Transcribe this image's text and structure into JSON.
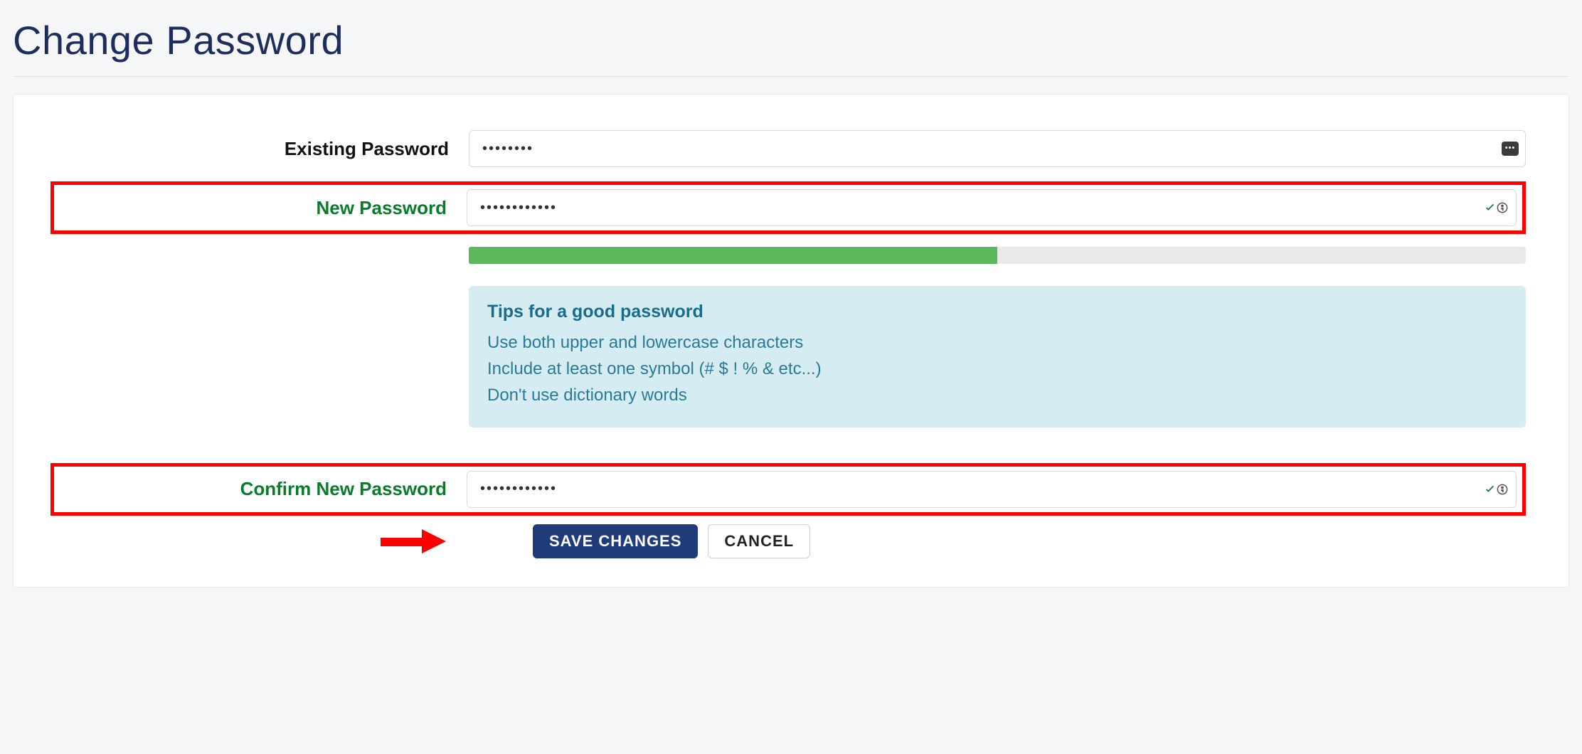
{
  "page": {
    "title": "Change Password"
  },
  "form": {
    "existing": {
      "label": "Existing Password",
      "value": "........"
    },
    "new": {
      "label": "New Password",
      "value": "............"
    },
    "confirm": {
      "label": "Confirm New Password",
      "value": "............"
    },
    "strength_percent": 50
  },
  "tips": {
    "title": "Tips for a good password",
    "lines": [
      "Use both upper and lowercase characters",
      "Include at least one symbol (# $ ! % & etc...)",
      "Don't use dictionary words"
    ]
  },
  "buttons": {
    "save": "SAVE CHANGES",
    "cancel": "CANCEL"
  },
  "colors": {
    "accent": "#1f3b7a",
    "valid": "#0a7b2a",
    "highlight_outline": "#ff0000",
    "strength_fill": "#5cb85c",
    "tips_bg": "#d5ecf3",
    "tips_text": "#2a7a96"
  }
}
